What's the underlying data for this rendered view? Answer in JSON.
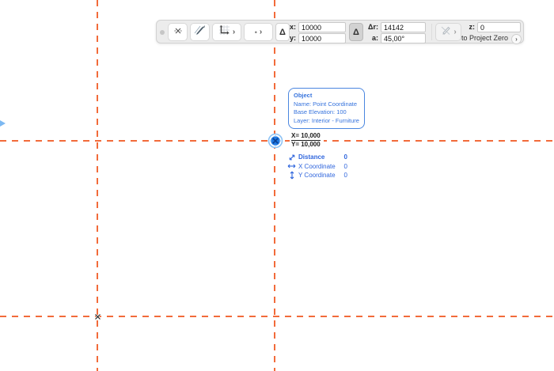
{
  "colors": {
    "guide_orange": "#F26B3A",
    "accent_blue": "#3673DD",
    "cursor_blue": "#2079E2",
    "toolbar_bg": "#ECECEC"
  },
  "icons": {
    "chevron_right": "›",
    "delta": "Δ",
    "dot": "•"
  },
  "toolbar": {
    "fields": {
      "x_label": "x:",
      "x_value": "10000",
      "y_label": "y:",
      "y_value": "10000",
      "dr_label": "Δr:",
      "dr_value": "14142",
      "a_label": "a:",
      "a_value": "45,00°",
      "z_label": "z:",
      "z_value": "0",
      "reference_label": "to Project Zero"
    }
  },
  "tooltip": {
    "title": "Object",
    "lines": [
      "Name: Point Coordinate",
      "Base Elevation: 100",
      "Layer: Interior - Furniture"
    ]
  },
  "coordinates": {
    "x": "X= 10,000",
    "y": "Y= 10,000"
  },
  "tracker": {
    "rows": [
      {
        "label": "Distance",
        "value": "0"
      },
      {
        "label": "X Coordinate",
        "value": "0"
      },
      {
        "label": "Y Coordinate",
        "value": "0"
      }
    ]
  }
}
